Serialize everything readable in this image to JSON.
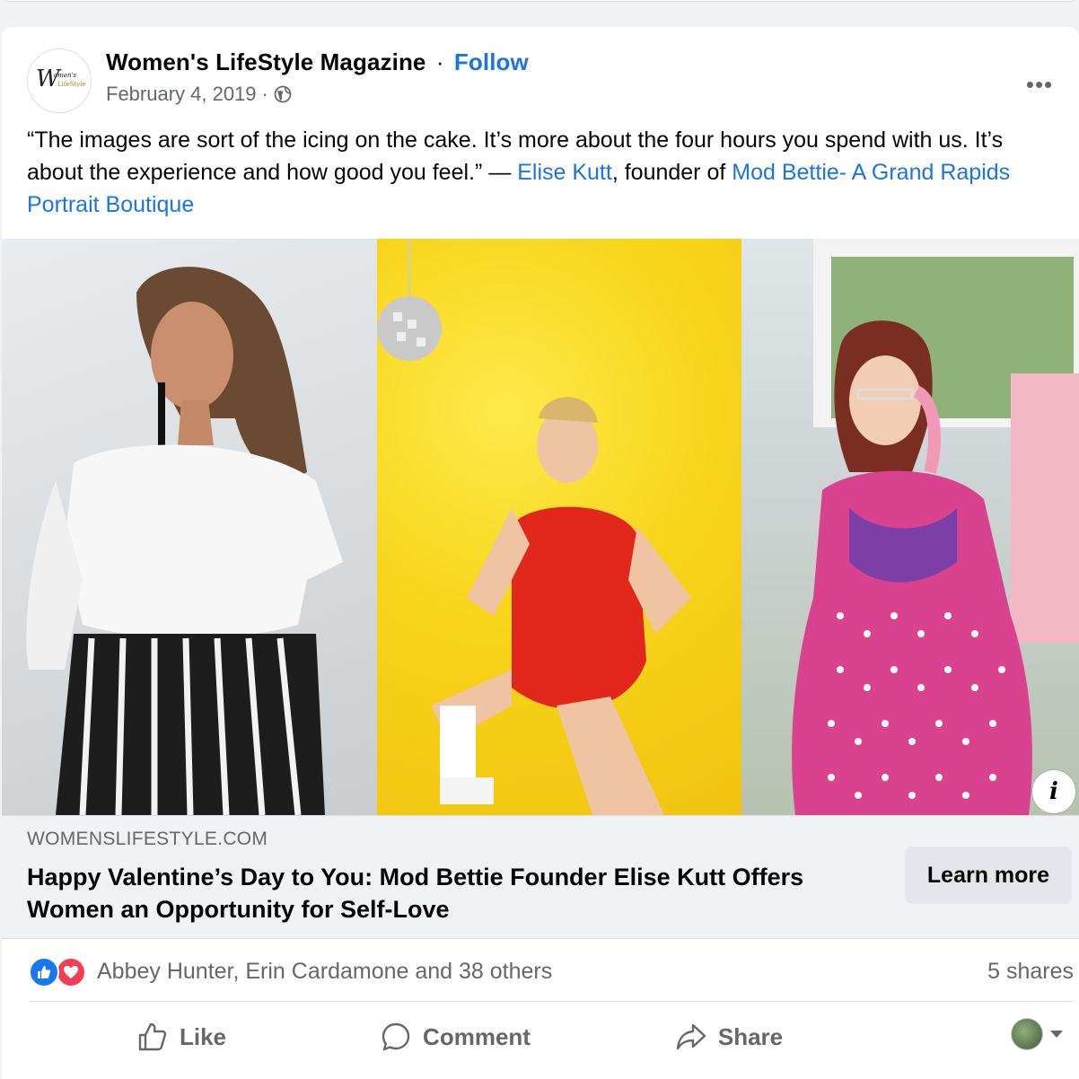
{
  "post": {
    "page_name": "Women's LifeStyle Magazine",
    "separator": "·",
    "follow_label": "Follow",
    "date": "February 4, 2019",
    "meta_separator": "·",
    "privacy_icon": "globe-icon",
    "more_icon": "more-options-icon",
    "more_label": "•••",
    "avatar_logo_text": "Women's LifeStyle",
    "caption": {
      "part1": "“The images are sort of the icing on the cake. It’s more about the four hours you spend with us. It’s about the experience and how good you feel.” — ",
      "link1": "Elise Kutt",
      "part2": ", founder of ",
      "link2": "Mod Bettie- A Grand Rapids Portrait Boutique"
    }
  },
  "media": {
    "photos": [
      "photo-woman-white-top",
      "photo-woman-red-swimsuit",
      "photo-woman-pink-polka-dress"
    ],
    "info_label": "i"
  },
  "link_preview": {
    "domain": "WOMENSLIFESTYLE.COM",
    "headline": "Happy Valentine’s Day to You: Mod Bettie Founder Elise Kutt Offers Women an Opportunity for Self-Love",
    "cta_label": "Learn more"
  },
  "engagement": {
    "reaction_icons": [
      "like-reaction-icon",
      "love-reaction-icon"
    ],
    "reactors": "Abbey Hunter, Erin Cardamone and 38 others",
    "shares": "5 shares"
  },
  "actions": {
    "like_label": "Like",
    "comment_label": "Comment",
    "share_label": "Share"
  },
  "colors": {
    "accent": "#1b74e4",
    "secondary_text": "#65676b",
    "like_blue": "#1877f2",
    "love_red": "#f33e58"
  }
}
